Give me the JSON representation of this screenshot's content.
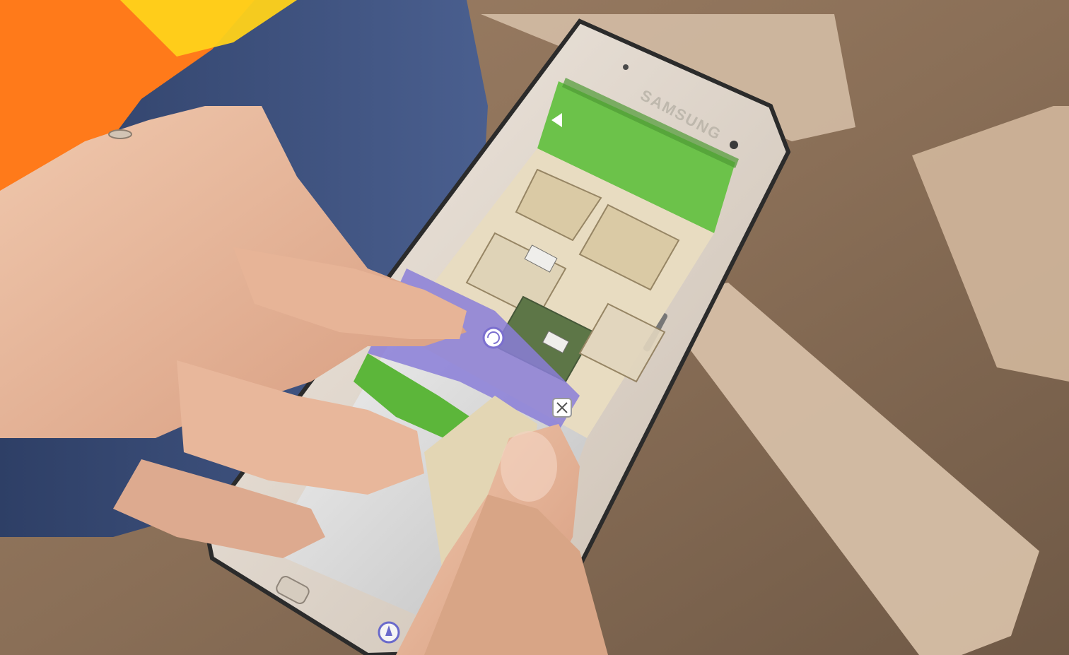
{
  "photo": {
    "subject": "hands-holding-smartphone-with-app",
    "phone": {
      "brand_text": "SAMSUNG"
    },
    "app": {
      "header_color": "#6cc24a",
      "plan_panel_color": "#e8dcc1",
      "view3d_accent_color": "#8a7ed8",
      "icons": [
        "back-arrow-icon",
        "rotate-icon",
        "close-x-icon",
        "compass-icon"
      ]
    },
    "scene_colors": {
      "background_wood": "#c9ab8e",
      "jeans": "#3a4d78",
      "vest_orange": "#ff7a1a",
      "skin": "#e8b89a",
      "phone_body": "#d9d0c5"
    }
  }
}
